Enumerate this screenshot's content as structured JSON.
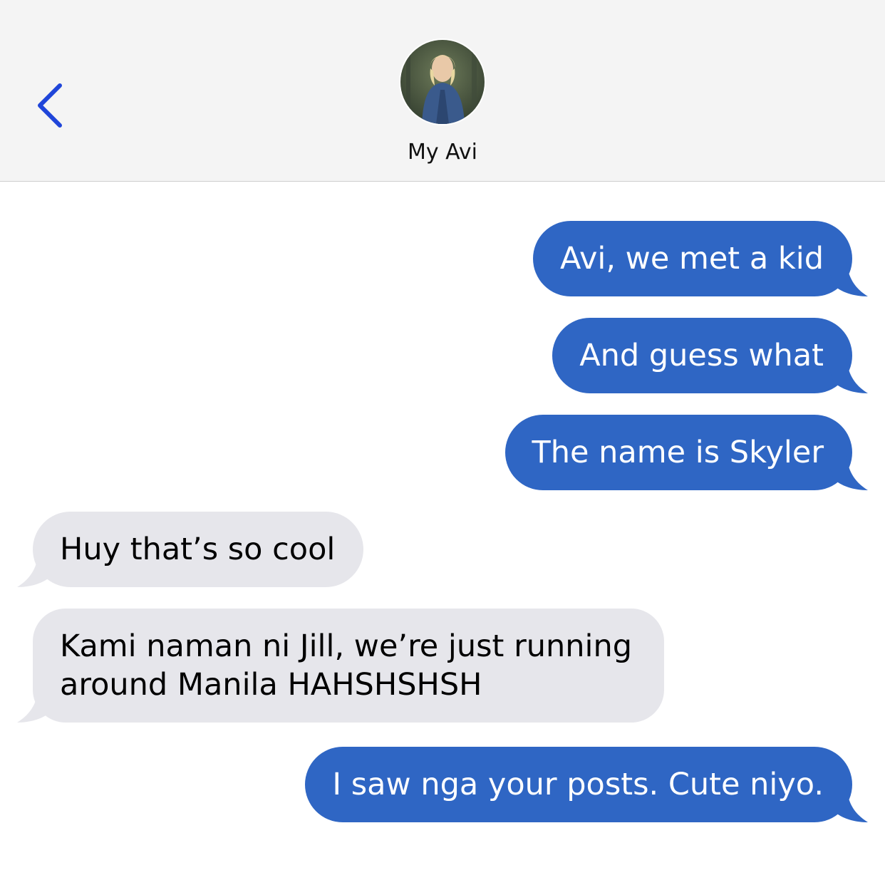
{
  "colors": {
    "sent_bubble": "#2f66c4",
    "received_bubble": "#e6e6eb",
    "header_bg": "#f4f4f4",
    "back_chevron": "#1f45d9"
  },
  "header": {
    "contact_name": "My Avi",
    "back_icon": "chevron-left-icon",
    "avatar_icon": "contact-avatar"
  },
  "messages": [
    {
      "from": "me",
      "text": "Avi, we met a kid"
    },
    {
      "from": "me",
      "text": "And guess what"
    },
    {
      "from": "me",
      "text": "The name is Skyler"
    },
    {
      "from": "them",
      "text": "Huy that’s so cool"
    },
    {
      "from": "them",
      "lines": [
        "Kami naman ni Jill, we’re just running",
        "around Manila HAHSHSHSH"
      ]
    },
    {
      "from": "me",
      "text": "I saw nga your posts. Cute niyo."
    }
  ]
}
